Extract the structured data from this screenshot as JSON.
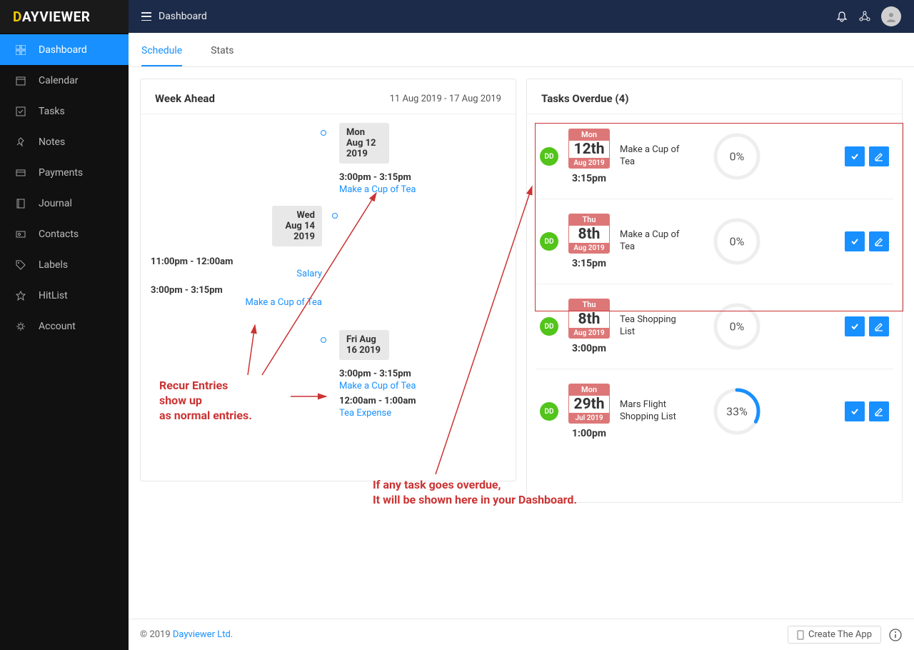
{
  "logo": {
    "d": "D",
    "rest": "AYVIEWER"
  },
  "topbar": {
    "title": "Dashboard"
  },
  "sidebar": {
    "items": [
      {
        "label": "Dashboard",
        "icon": "dashboard"
      },
      {
        "label": "Calendar",
        "icon": "calendar"
      },
      {
        "label": "Tasks",
        "icon": "check-square"
      },
      {
        "label": "Notes",
        "icon": "pin"
      },
      {
        "label": "Payments",
        "icon": "credit-card"
      },
      {
        "label": "Journal",
        "icon": "book"
      },
      {
        "label": "Contacts",
        "icon": "idcard"
      },
      {
        "label": "Labels",
        "icon": "tag"
      },
      {
        "label": "HitList",
        "icon": "star"
      },
      {
        "label": "Account",
        "icon": "gear"
      }
    ]
  },
  "tabs": {
    "schedule": "Schedule",
    "stats": "Stats"
  },
  "weekAhead": {
    "title": "Week Ahead",
    "range": "11 Aug 2019 - 17 Aug 2019",
    "events": [
      {
        "date": "Mon Aug 12 2019",
        "time": "3:00pm - 3:15pm",
        "title": "Make a Cup of Tea"
      },
      {
        "date": "Wed Aug 14 2019",
        "time1": "11:00pm - 12:00am",
        "title1": "Salary",
        "time2": "3:00pm - 3:15pm",
        "title2": "Make a Cup of Tea"
      },
      {
        "date": "Fri Aug 16 2019",
        "time1": "3:00pm - 3:15pm",
        "title1": "Make a Cup of Tea",
        "time2": "12:00am - 1:00am",
        "title2": "Tea Expense"
      }
    ]
  },
  "overdue": {
    "title": "Tasks Overdue (4)",
    "tasks": [
      {
        "day": "Mon",
        "num": "12th",
        "month": "Aug 2019",
        "time": "3:15pm",
        "title": "Make a Cup of Tea",
        "pct": "0%",
        "pctVal": 0
      },
      {
        "day": "Thu",
        "num": "8th",
        "month": "Aug 2019",
        "time": "3:15pm",
        "title": "Make a Cup of Tea",
        "pct": "0%",
        "pctVal": 0
      },
      {
        "day": "Thu",
        "num": "8th",
        "month": "Aug 2019",
        "time": "3:00pm",
        "title": "Tea Shopping List",
        "pct": "0%",
        "pctVal": 0
      },
      {
        "day": "Mon",
        "num": "29th",
        "month": "Jul 2019",
        "time": "1:00pm",
        "title": "Mars Flight Shopping List",
        "pct": "33%",
        "pctVal": 33
      }
    ]
  },
  "annotations": {
    "recur": "Recur Entries\nshow up\nas normal entries.",
    "overdueNote": "If any task goes overdue,\nIt will be shown here in your Dashboard."
  },
  "footer": {
    "copyright": "© 2019 ",
    "link": "Dayviewer Ltd.",
    "createApp": "Create The App"
  },
  "dd": "DD"
}
